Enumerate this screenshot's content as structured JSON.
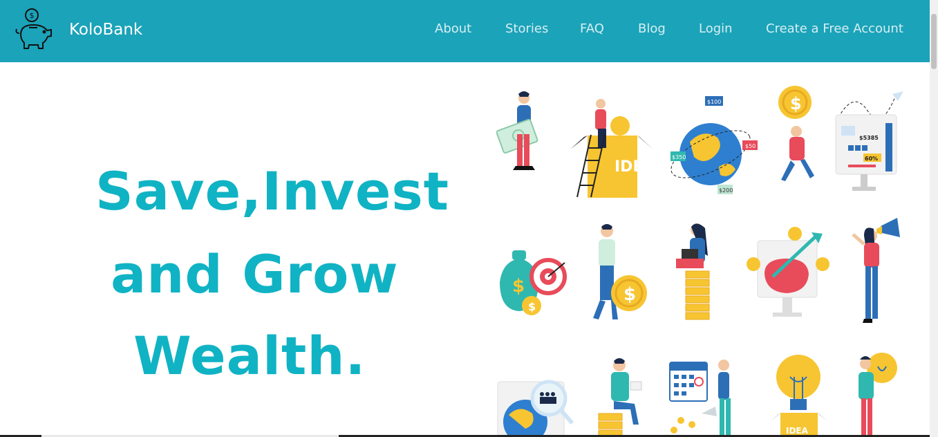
{
  "brand": {
    "name": "KoloBank",
    "logo_icon": "piggy-bank-icon"
  },
  "nav": {
    "links": [
      "About",
      "Stories",
      "FAQ",
      "Blog",
      "Login",
      "Create a Free Account"
    ]
  },
  "hero": {
    "line1": "Save,Invest",
    "line2": "and Grow",
    "line3": "Wealth."
  },
  "illustrations": {
    "labels": {
      "idea": "IDEA",
      "price_100": "$100",
      "price_350": "$350",
      "price_50": "$50",
      "price_200": "$200",
      "price_5385": "$5385",
      "percent_60": "60%"
    }
  },
  "colors": {
    "navbar": "#1ba3b9",
    "hero_text": "#10b3c4",
    "coin": "#f7c531",
    "accent_red": "#e84b5a",
    "accent_blue": "#2d6fb7"
  }
}
